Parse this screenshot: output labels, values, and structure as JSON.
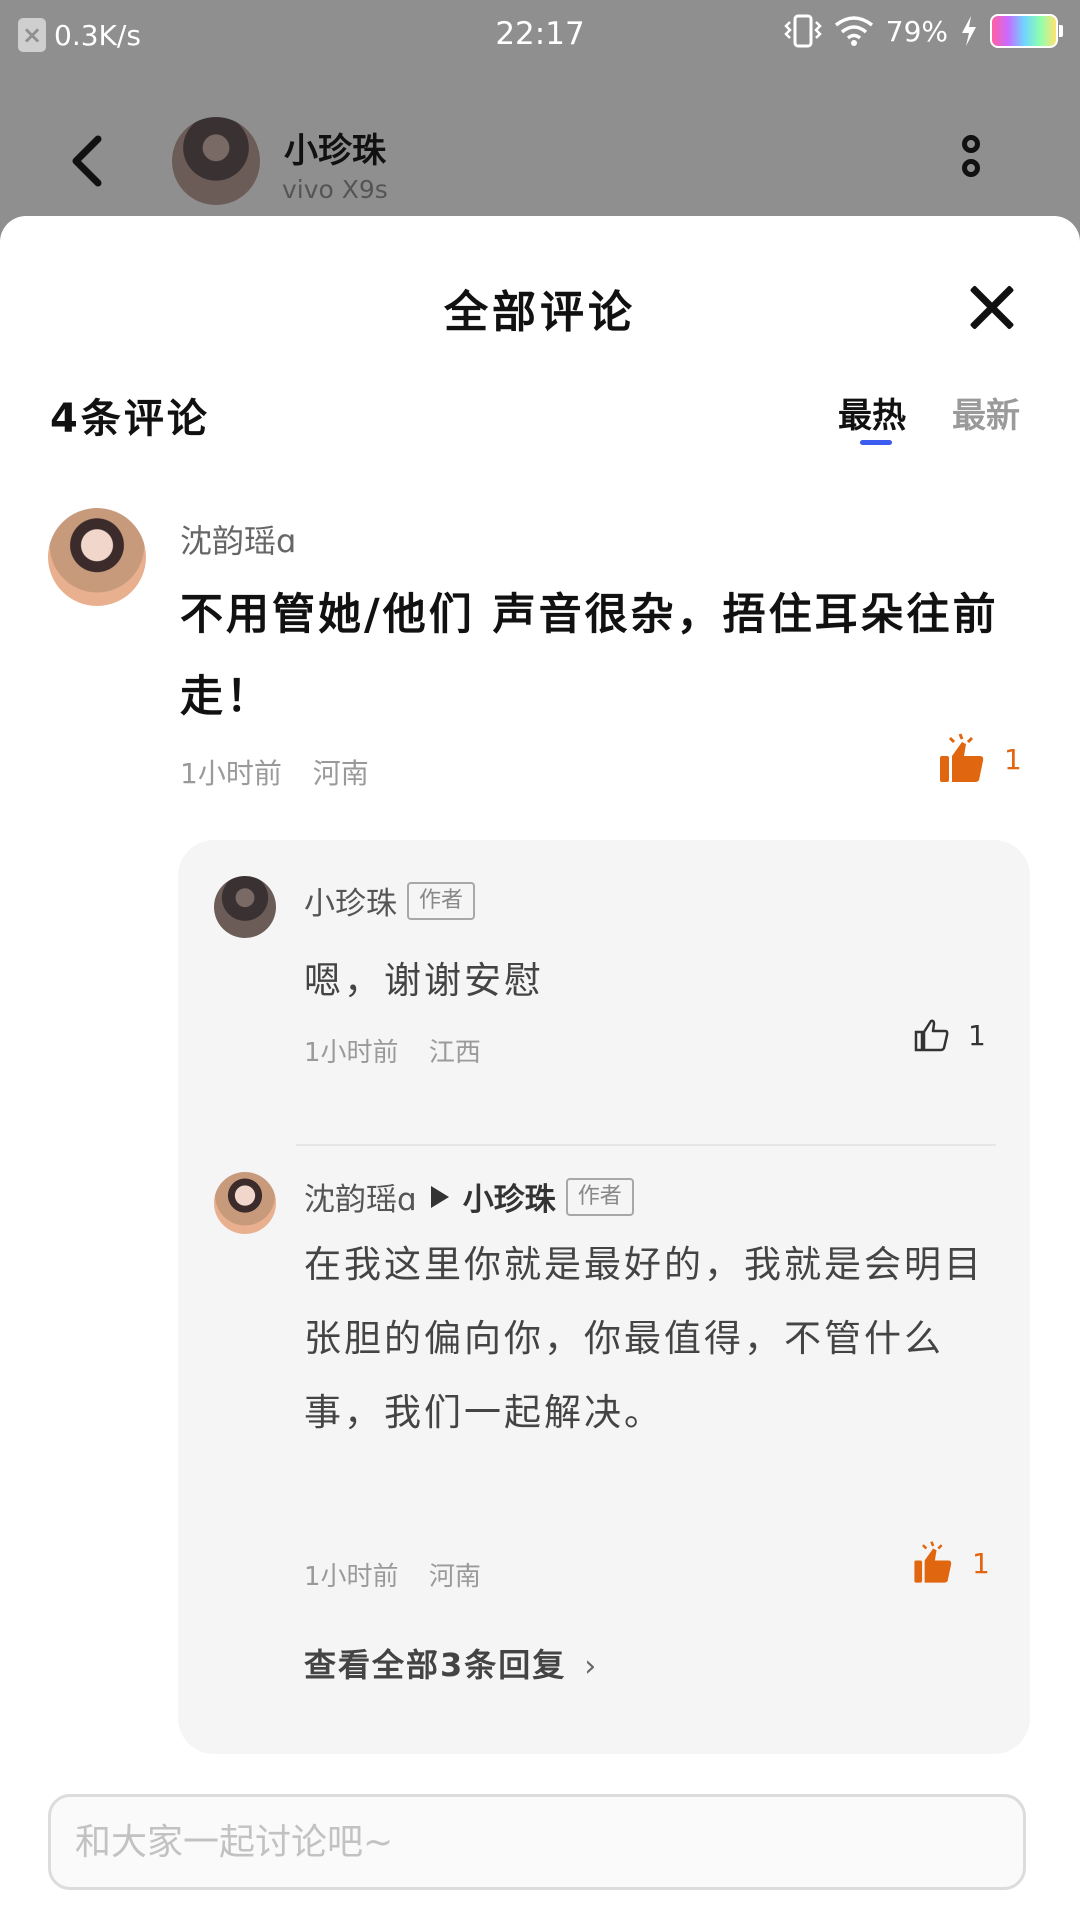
{
  "status_bar": {
    "net_speed": "0.3K/s",
    "time": "22:17",
    "battery_percent": "79%"
  },
  "header": {
    "user_name": "小珍珠",
    "device": "vivo X9s"
  },
  "sheet": {
    "title": "全部评论",
    "count_label": "4条评论",
    "tabs": {
      "hot": "最热",
      "new": "最新"
    }
  },
  "comment": {
    "author": "沈韵瑶ɑ",
    "text": "不用管她/他们 声音很杂，捂住耳朵往前走！",
    "time": "1小时前",
    "location": "河南",
    "likes": "1"
  },
  "replies": [
    {
      "author": "小珍珠",
      "tag": "作者",
      "text": "嗯，谢谢安慰",
      "time": "1小时前",
      "location": "江西",
      "likes": "1"
    },
    {
      "author": "沈韵瑶ɑ",
      "reply_to": "小珍珠",
      "tag": "作者",
      "text": "在我这里你就是最好的，我就是会明目张胆的偏向你，你最值得，不管什么事，我们一起解决。",
      "time": "1小时前",
      "location": "河南",
      "likes": "1"
    }
  ],
  "view_all_label": "查看全部3条回复",
  "input": {
    "placeholder": "和大家一起讨论吧~",
    "value": ""
  },
  "colors": {
    "accent": "#3c5bf0",
    "liked": "#e0660f"
  },
  "icons": [
    "back-arrow-icon",
    "more-icon",
    "close-icon",
    "thumbs-up-icon"
  ]
}
